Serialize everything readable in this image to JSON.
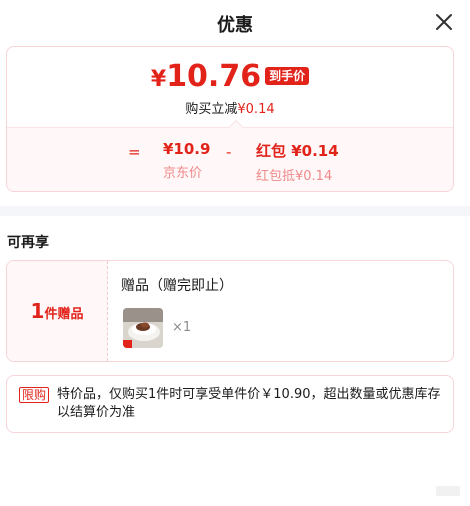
{
  "header": {
    "title": "优惠",
    "close_icon": "close-icon"
  },
  "price_card": {
    "currency": "¥",
    "final_price": "10.76",
    "final_tag": "到手价",
    "save_prefix": "购买立减",
    "save_amount": "¥0.14",
    "equals": "=",
    "minus": "-",
    "jd_value": "¥10.9",
    "jd_label": "京东价",
    "hb_value": "红包 ¥0.14",
    "hb_label": "红包抵¥0.14"
  },
  "section": {
    "title": "可再享"
  },
  "gift": {
    "count": "1",
    "count_unit": "件赠品",
    "title": "赠品（赠完即止）",
    "thumb_icon": "gift-product-image",
    "qty": "×1"
  },
  "notice": {
    "tag": "限购",
    "text": "特价品，仅购买1件时可享受单件价￥10.90，超出数量或优惠库存以结算价为准"
  },
  "colors": {
    "accent": "#e2231a",
    "card_border": "#f7d4d8",
    "card_tint": "#fff7f8"
  }
}
